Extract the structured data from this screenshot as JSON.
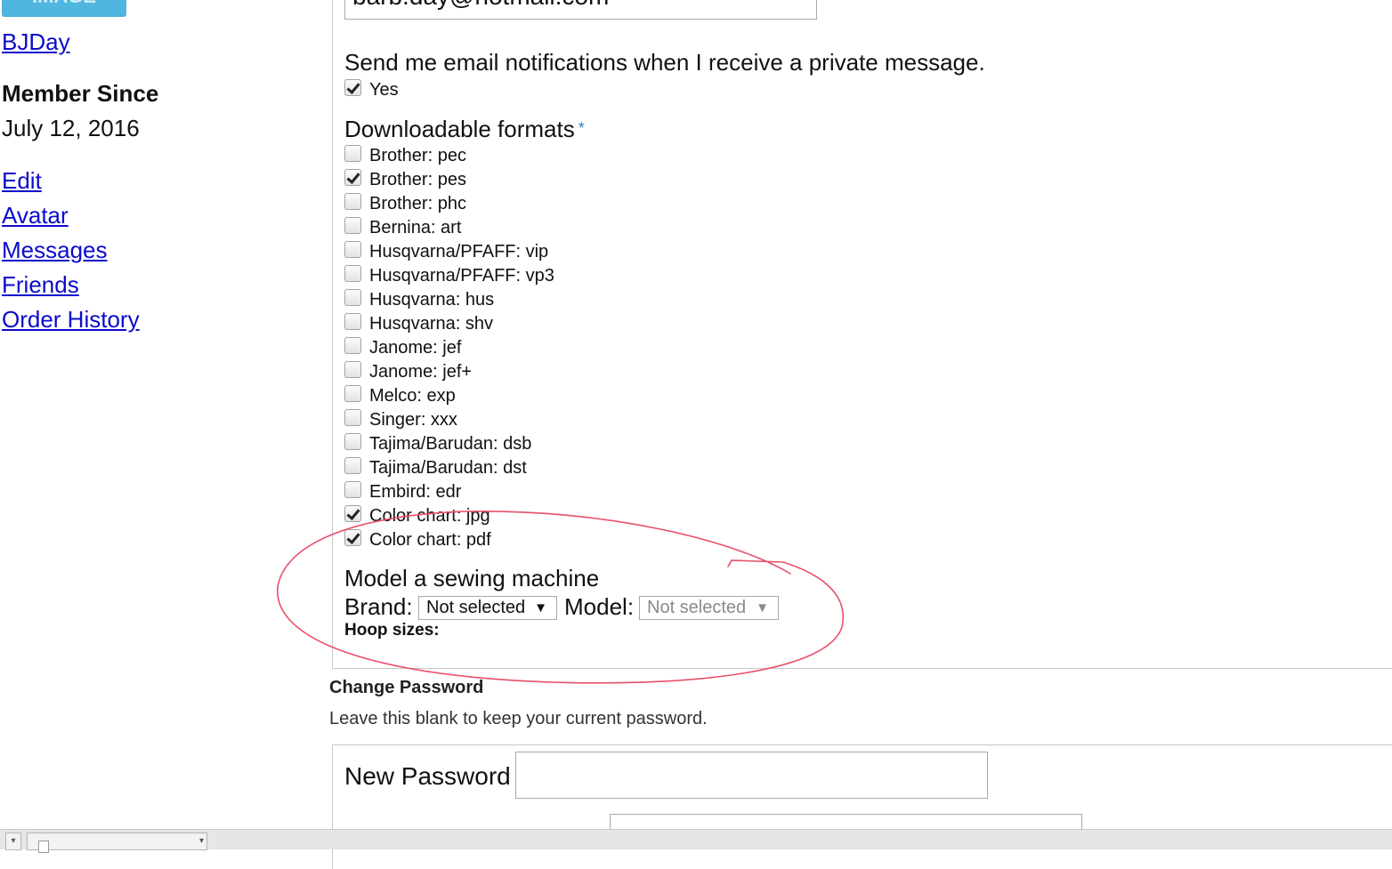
{
  "sidebar": {
    "avatar_text": "IMAGE",
    "username": "BJDay",
    "member_since_heading": "Member Since",
    "member_since_date": "July 12, 2016",
    "links": [
      "Edit",
      "Avatar",
      "Messages",
      "Friends",
      "Order History"
    ]
  },
  "account": {
    "email_value": "barb.day@hotmail.com",
    "notifications_title": "Send me email notifications when I receive a private message.",
    "notifications_option": "Yes",
    "notifications_checked": true
  },
  "formats": {
    "title": "Downloadable formats",
    "required_mark": "*",
    "options": [
      {
        "label": "Brother: pec",
        "checked": false
      },
      {
        "label": "Brother: pes",
        "checked": true
      },
      {
        "label": "Brother: phc",
        "checked": false
      },
      {
        "label": "Bernina: art",
        "checked": false
      },
      {
        "label": "Husqvarna/PFAFF: vip",
        "checked": false
      },
      {
        "label": "Husqvarna/PFAFF: vp3",
        "checked": false
      },
      {
        "label": "Husqvarna: hus",
        "checked": false
      },
      {
        "label": "Husqvarna: shv",
        "checked": false
      },
      {
        "label": "Janome: jef",
        "checked": false
      },
      {
        "label": "Janome: jef+",
        "checked": false
      },
      {
        "label": "Melco: exp",
        "checked": false
      },
      {
        "label": "Singer: xxx",
        "checked": false
      },
      {
        "label": "Tajima/Barudan: dsb",
        "checked": false
      },
      {
        "label": "Tajima/Barudan: dst",
        "checked": false
      },
      {
        "label": "Embird: edr",
        "checked": false
      },
      {
        "label": "Color chart: jpg",
        "checked": true
      },
      {
        "label": "Color chart: pdf",
        "checked": true
      }
    ]
  },
  "machine": {
    "title": "Model a sewing machine",
    "brand_label": "Brand:",
    "brand_value": "Not selected",
    "model_label": "Model:",
    "model_value": "Not selected",
    "hoop_label": "Hoop sizes:",
    "arrow_glyph": "▼"
  },
  "password": {
    "title": "Change Password",
    "hint": "Leave this blank to keep your current password.",
    "new_label": "New Password"
  },
  "colors": {
    "link": "#0b0bcc",
    "annotation": "#e8506a",
    "avatar_bg": "#4eb6df"
  }
}
